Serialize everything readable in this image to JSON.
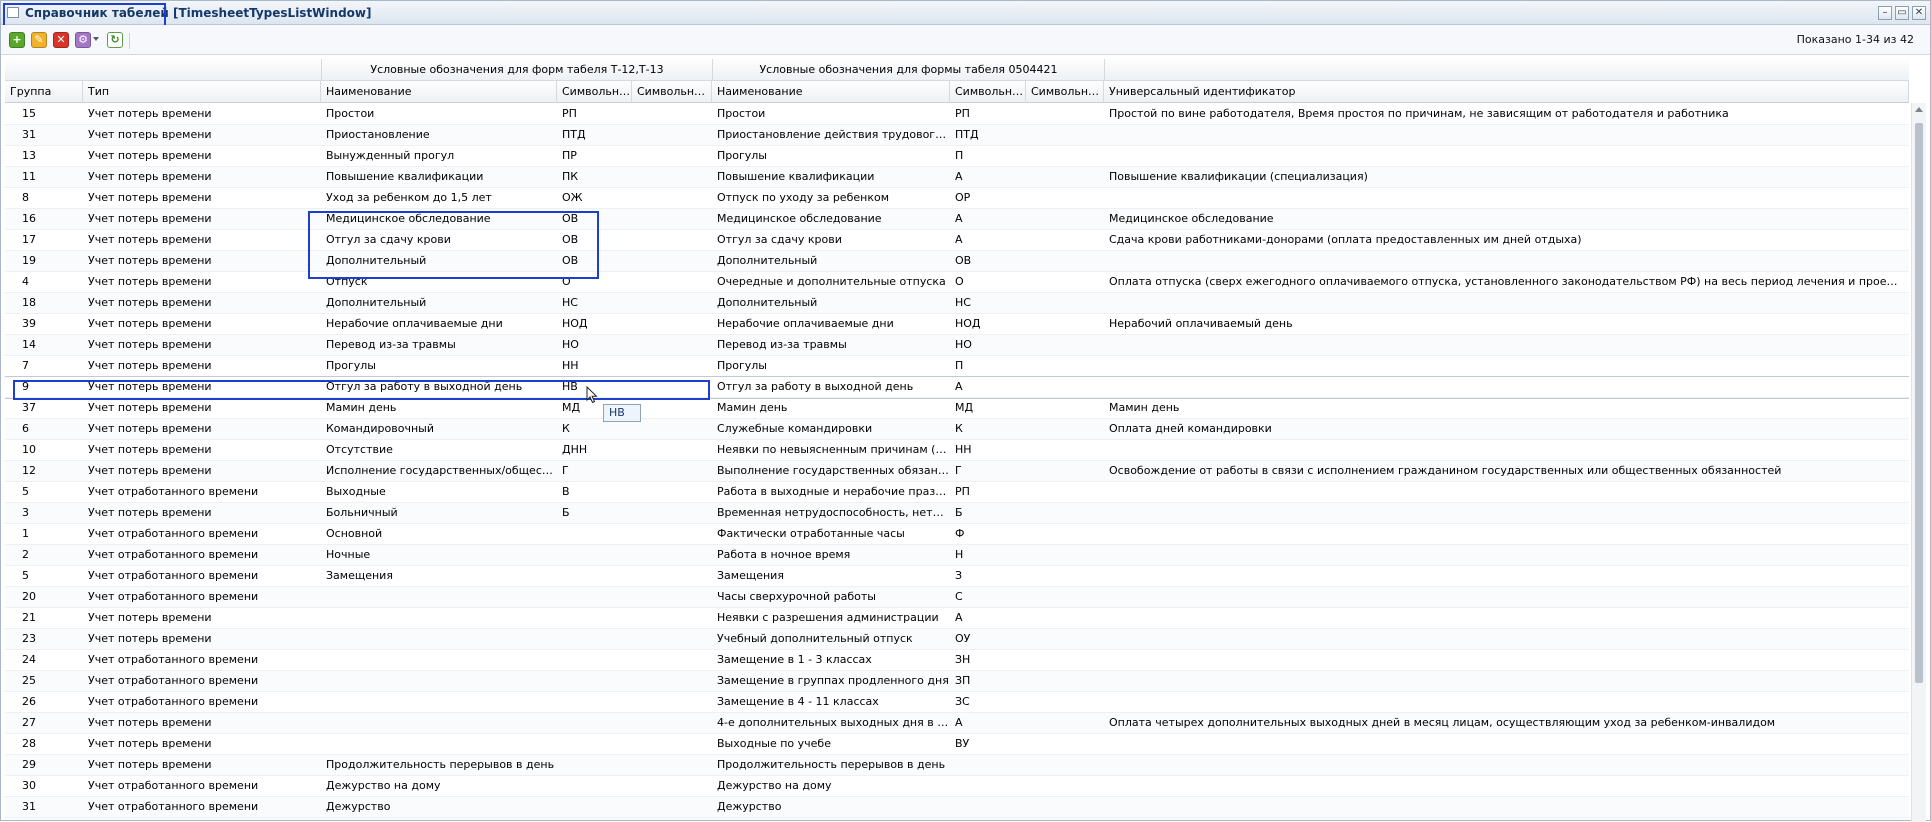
{
  "window": {
    "title": "Справочник табелей [TimesheetTypesListWindow]",
    "minimize": "–",
    "maximize": "▭",
    "close": "✕"
  },
  "toolbar": {
    "add": "+",
    "edit": "✎",
    "delete": "✕",
    "multi": "⚙",
    "refresh": "↻",
    "shown": "Показано 1-34 из 42"
  },
  "column_groups": {
    "group1": "Условные обозначения для форм табеля Т-12,Т-13",
    "group2": "Условные обозначения для формы табеля 0504421"
  },
  "columns": {
    "group": "Группа",
    "type": "Тип",
    "name1": "Наименование",
    "sym1": "Символьно...",
    "sym2": "Символьно...",
    "name2": "Наименование",
    "sym3": "Символьно...",
    "sym4": "Символьно...",
    "uid": "Универсальный идентификатор"
  },
  "tooltip": "НВ",
  "rows": [
    {
      "g": "15",
      "t": "Учет потерь времени",
      "n1": "Простои",
      "s1": "РП",
      "s2": "",
      "n2": "Простои",
      "s3": "РП",
      "s4": "",
      "u": "Простой по вине работодателя, Время простоя по причинам, не зависящим от работодателя и работника"
    },
    {
      "g": "31",
      "t": "Учет потерь времени",
      "n1": "Приостановление",
      "s1": "ПТД",
      "s2": "",
      "n2": "Приостановление действия трудового дог...",
      "s3": "ПТД",
      "s4": "",
      "u": ""
    },
    {
      "g": "13",
      "t": "Учет потерь времени",
      "n1": "Вынужденный прогул",
      "s1": "ПР",
      "s2": "",
      "n2": "Прогулы",
      "s3": "П",
      "s4": "",
      "u": ""
    },
    {
      "g": "11",
      "t": "Учет потерь времени",
      "n1": "Повышение квалификации",
      "s1": "ПК",
      "s2": "",
      "n2": "Повышение квалификации",
      "s3": "А",
      "s4": "",
      "u": "Повышение квалификации (специализация)"
    },
    {
      "g": "8",
      "t": "Учет потерь времени",
      "n1": "Уход за ребенком до 1,5 лет",
      "s1": "ОЖ",
      "s2": "",
      "n2": "Отпуск по уходу за ребенком",
      "s3": "ОР",
      "s4": "",
      "u": ""
    },
    {
      "g": "16",
      "t": "Учет потерь времени",
      "n1": "Медицинское обследование",
      "s1": "ОВ",
      "s2": "",
      "n2": "Медицинское обследование",
      "s3": "А",
      "s4": "",
      "u": "Медицинское обследование"
    },
    {
      "g": "17",
      "t": "Учет потерь времени",
      "n1": "Отгул за сдачу крови",
      "s1": "ОВ",
      "s2": "",
      "n2": "Отгул за сдачу крови",
      "s3": "А",
      "s4": "",
      "u": "Сдача крови работниками-донорами (оплата предоставленных им дней отдыха)"
    },
    {
      "g": "19",
      "t": "Учет потерь времени",
      "n1": "Дополнительный",
      "s1": "ОВ",
      "s2": "",
      "n2": "Дополнительный",
      "s3": "ОВ",
      "s4": "",
      "u": ""
    },
    {
      "g": "4",
      "t": "Учет потерь времени",
      "n1": "Отпуск",
      "s1": "О",
      "s2": "",
      "n2": "Очередные и дополнительные отпуска",
      "s3": "О",
      "s4": "",
      "u": "Оплата отпуска (сверх ежегодного оплачиваемого отпуска, установленного законодательством РФ) на весь период лечения и проезда к месту лечения ..."
    },
    {
      "g": "18",
      "t": "Учет потерь времени",
      "n1": "Дополнительный",
      "s1": "НС",
      "s2": "",
      "n2": "Дополнительный",
      "s3": "НС",
      "s4": "",
      "u": ""
    },
    {
      "g": "39",
      "t": "Учет потерь времени",
      "n1": "Нерабочие оплачиваемые дни",
      "s1": "НОД",
      "s2": "",
      "n2": "Нерабочие оплачиваемые дни",
      "s3": "НОД",
      "s4": "",
      "u": "Нерабочий оплачиваемый день"
    },
    {
      "g": "14",
      "t": "Учет потерь времени",
      "n1": "Перевод из-за травмы",
      "s1": "НО",
      "s2": "",
      "n2": "Перевод из-за травмы",
      "s3": "НО",
      "s4": "",
      "u": ""
    },
    {
      "g": "7",
      "t": "Учет потерь времени",
      "n1": "Прогулы",
      "s1": "НН",
      "s2": "",
      "n2": "Прогулы",
      "s3": "П",
      "s4": "",
      "u": ""
    },
    {
      "g": "9",
      "t": "Учет потерь времени",
      "n1": "Отгул за работу в выходной день",
      "s1": "НВ",
      "s2": "",
      "n2": "Отгул за работу в выходной день",
      "s3": "А",
      "s4": "",
      "u": ""
    },
    {
      "g": "37",
      "t": "Учет потерь времени",
      "n1": "Мамин день",
      "s1": "МД",
      "s2": "",
      "n2": "Мамин день",
      "s3": "МД",
      "s4": "",
      "u": "Мамин день"
    },
    {
      "g": "6",
      "t": "Учет потерь времени",
      "n1": "Командировочный",
      "s1": "К",
      "s2": "",
      "n2": "Служебные командировки",
      "s3": "К",
      "s4": "",
      "u": "Оплата дней командировки"
    },
    {
      "g": "10",
      "t": "Учет потерь времени",
      "n1": "Отсутствие",
      "s1": "ДНН",
      "s2": "",
      "n2": "Неявки по невыясненным причинам (до в...",
      "s3": "НН",
      "s4": "",
      "u": ""
    },
    {
      "g": "12",
      "t": "Учет потерь времени",
      "n1": "Исполнение государственных/общественн...",
      "s1": "Г",
      "s2": "",
      "n2": "Выполнение государственных обязанностей",
      "s3": "Г",
      "s4": "",
      "u": "Освобождение от работы в связи с исполнением гражданином государственных или общественных обязанностей"
    },
    {
      "g": "5",
      "t": "Учет отработанного времени",
      "n1": "Выходные",
      "s1": "В",
      "s2": "",
      "n2": "Работа в выходные и нерабочие празднич...",
      "s3": "РП",
      "s4": "",
      "u": ""
    },
    {
      "g": "3",
      "t": "Учет потерь времени",
      "n1": "Больничный",
      "s1": "Б",
      "s2": "",
      "n2": "Временная нетрудоспособность, нетрудос...",
      "s3": "Б",
      "s4": "",
      "u": ""
    },
    {
      "g": "1",
      "t": "Учет отработанного времени",
      "n1": "Основной",
      "s1": "",
      "s2": "",
      "n2": "Фактически отработанные часы",
      "s3": "Ф",
      "s4": "",
      "u": ""
    },
    {
      "g": "2",
      "t": "Учет отработанного времени",
      "n1": "Ночные",
      "s1": "",
      "s2": "",
      "n2": "Работа в ночное время",
      "s3": "Н",
      "s4": "",
      "u": ""
    },
    {
      "g": "5",
      "t": "Учет отработанного времени",
      "n1": "Замещения",
      "s1": "",
      "s2": "",
      "n2": "Замещения",
      "s3": "З",
      "s4": "",
      "u": ""
    },
    {
      "g": "20",
      "t": "Учет отработанного времени",
      "n1": "",
      "s1": "",
      "s2": "",
      "n2": "Часы сверхурочной работы",
      "s3": "С",
      "s4": "",
      "u": ""
    },
    {
      "g": "21",
      "t": "Учет потерь времени",
      "n1": "",
      "s1": "",
      "s2": "",
      "n2": "Неявки с разрешения администрации",
      "s3": "А",
      "s4": "",
      "u": ""
    },
    {
      "g": "23",
      "t": "Учет потерь времени",
      "n1": "",
      "s1": "",
      "s2": "",
      "n2": "Учебный дополнительный отпуск",
      "s3": "ОУ",
      "s4": "",
      "u": ""
    },
    {
      "g": "24",
      "t": "Учет отработанного времени",
      "n1": "",
      "s1": "",
      "s2": "",
      "n2": "Замещение в 1 - 3 классах",
      "s3": "ЗН",
      "s4": "",
      "u": ""
    },
    {
      "g": "25",
      "t": "Учет отработанного времени",
      "n1": "",
      "s1": "",
      "s2": "",
      "n2": "Замещение в группах продленного дня",
      "s3": "ЗП",
      "s4": "",
      "u": ""
    },
    {
      "g": "26",
      "t": "Учет отработанного времени",
      "n1": "",
      "s1": "",
      "s2": "",
      "n2": "Замещение в 4 - 11 классах",
      "s3": "ЗС",
      "s4": "",
      "u": ""
    },
    {
      "g": "27",
      "t": "Учет потерь времени",
      "n1": "",
      "s1": "",
      "s2": "",
      "n2": "4-е дополнительных выходных дня в меся...",
      "s3": "А",
      "s4": "",
      "u": "Оплата четырех дополнительных выходных дней в месяц лицам, осуществляющим уход за ребенком-инвалидом"
    },
    {
      "g": "28",
      "t": "Учет потерь времени",
      "n1": "",
      "s1": "",
      "s2": "",
      "n2": "Выходные по учебе",
      "s3": "ВУ",
      "s4": "",
      "u": ""
    },
    {
      "g": "29",
      "t": "Учет потерь времени",
      "n1": "Продолжительность перерывов в день",
      "s1": "",
      "s2": "",
      "n2": "Продолжительность перерывов в день",
      "s3": "",
      "s4": "",
      "u": ""
    },
    {
      "g": "30",
      "t": "Учет отработанного времени",
      "n1": "Дежурство на дому",
      "s1": "",
      "s2": "",
      "n2": "Дежурство на дому",
      "s3": "",
      "s4": "",
      "u": ""
    },
    {
      "g": "31",
      "t": "Учет отработанного времени",
      "n1": "Дежурство",
      "s1": "",
      "s2": "",
      "n2": "Дежурство",
      "s3": "",
      "s4": "",
      "u": ""
    }
  ]
}
